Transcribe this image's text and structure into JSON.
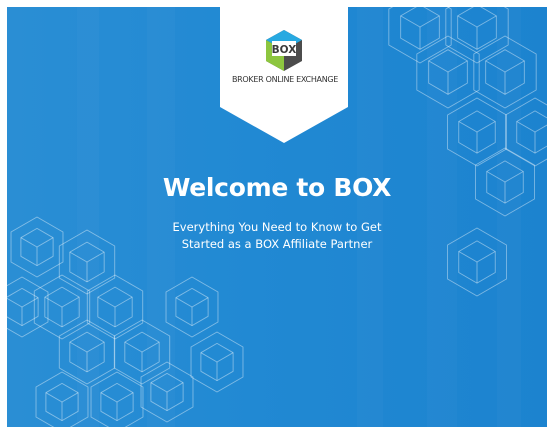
{
  "slide": {
    "background_color": "#2189d3",
    "logo": {
      "mark_text": "BOX",
      "caption": "BROKER ONLINE EXCHANGE",
      "colors": [
        "#4c4c4c",
        "#27a9e1",
        "#8dc63f",
        "#ffffff"
      ]
    },
    "title": "Welcome to BOX",
    "subtitle_lines": [
      "Everything You Need to Know to Get",
      "Started as a BOX Affiliate Partner"
    ]
  }
}
